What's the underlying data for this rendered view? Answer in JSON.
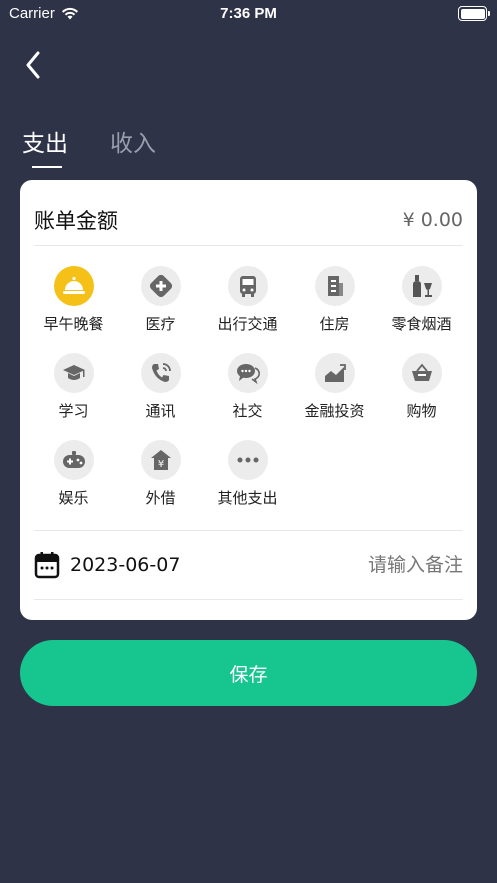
{
  "status": {
    "carrier": "Carrier",
    "time": "7:36 PM"
  },
  "tabs": [
    {
      "label": "支出",
      "active": true
    },
    {
      "label": "收入",
      "active": false
    }
  ],
  "amount": {
    "label": "账单金额",
    "value": "¥ 0.00"
  },
  "categories": [
    {
      "label": "早午晚餐",
      "icon": "dining-bell-icon",
      "selected": true
    },
    {
      "label": "医疗",
      "icon": "medical-cross-icon"
    },
    {
      "label": "出行交通",
      "icon": "bus-icon"
    },
    {
      "label": "住房",
      "icon": "building-icon"
    },
    {
      "label": "零食烟酒",
      "icon": "bottle-glass-icon"
    },
    {
      "label": "学习",
      "icon": "graduation-cap-icon"
    },
    {
      "label": "通讯",
      "icon": "phone-icon"
    },
    {
      "label": "社交",
      "icon": "chat-bubbles-icon"
    },
    {
      "label": "金融投资",
      "icon": "trend-chart-icon"
    },
    {
      "label": "购物",
      "icon": "shopping-basket-icon"
    },
    {
      "label": "娱乐",
      "icon": "gamepad-icon"
    },
    {
      "label": "外借",
      "icon": "yuan-house-icon"
    },
    {
      "label": "其他支出",
      "icon": "more-dots-icon"
    }
  ],
  "date": "2023-06-07",
  "note": {
    "placeholder": "请输入备注"
  },
  "save_label": "保存",
  "colors": {
    "background": "#2f3347",
    "accent": "#17c68f",
    "selected_icon": "#f5c118"
  }
}
